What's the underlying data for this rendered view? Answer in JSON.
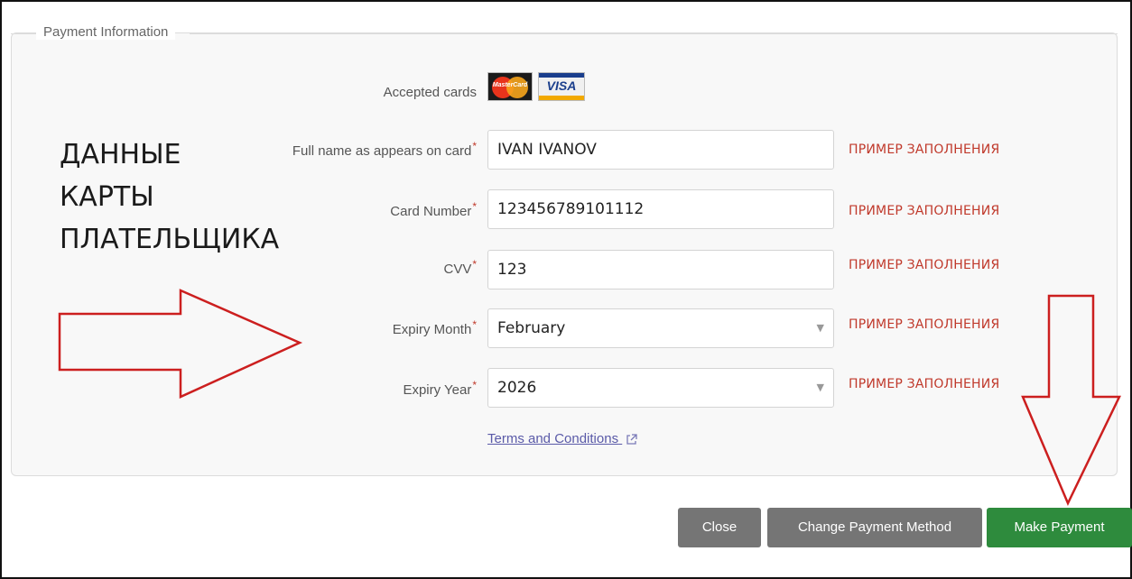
{
  "section": {
    "legend": "Payment Information"
  },
  "caption": {
    "lines": [
      "ДАННЫЕ",
      "КАРТЫ",
      "ПЛАТЕЛЬЩИКА"
    ]
  },
  "accepted_cards": {
    "label": "Accepted cards",
    "cards": [
      "MasterCard",
      "VISA"
    ]
  },
  "fields": {
    "full_name": {
      "label": "Full name as appears on card",
      "required_mark": "*",
      "value": "IVAN IVANOV",
      "hint": "ПРИМЕР ЗАПОЛНЕНИЯ"
    },
    "card_number": {
      "label": "Card Number",
      "required_mark": "*",
      "value": "123456789101112",
      "hint": "ПРИМЕР ЗАПОЛНЕНИЯ"
    },
    "cvv": {
      "label": "CVV",
      "required_mark": "*",
      "value": "123",
      "hint": "ПРИМЕР ЗАПОЛНЕНИЯ"
    },
    "expiry_month": {
      "label": "Expiry Month",
      "required_mark": "*",
      "value": "February",
      "hint": "ПРИМЕР ЗАПОЛНЕНИЯ"
    },
    "expiry_year": {
      "label": "Expiry Year",
      "required_mark": "*",
      "value": "2026",
      "hint": "ПРИМЕР ЗАПОЛНЕНИЯ"
    }
  },
  "terms": {
    "label": "Terms and Conditions",
    "icon": "external-link-icon"
  },
  "buttons": {
    "close": "Close",
    "change_method": "Change Payment Method",
    "make_payment": "Make Payment"
  },
  "colors": {
    "hint_red": "#c0392b",
    "primary_green": "#2e8b3d",
    "secondary_gray": "#757575",
    "annotation_arrow": "#cc1f1f"
  }
}
